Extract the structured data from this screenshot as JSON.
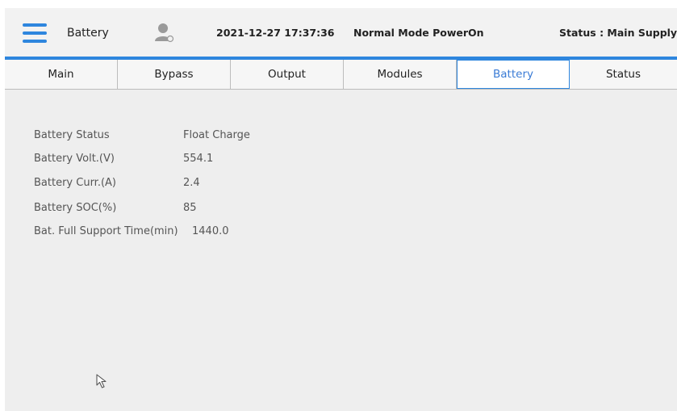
{
  "header": {
    "title": "Battery",
    "datetime": "2021-12-27 17:37:36",
    "mode": "Normal Mode  PowerOn",
    "status": "Status : Main Supply",
    "accent_color": "#2e86de"
  },
  "tabs": [
    {
      "label": "Main"
    },
    {
      "label": "Bypass"
    },
    {
      "label": "Output"
    },
    {
      "label": "Modules"
    },
    {
      "label": "Battery",
      "active": true
    },
    {
      "label": "Status"
    }
  ],
  "battery": [
    {
      "label": "Battery Status",
      "value": "Float Charge"
    },
    {
      "label": "Battery Volt.(V)",
      "value": "554.1"
    },
    {
      "label": "Battery Curr.(A)",
      "value": "2.4"
    },
    {
      "label": "Battery SOC(%)",
      "value": "85"
    },
    {
      "label": "Bat. Full Support Time(min)",
      "value": "1440.0"
    }
  ],
  "icons": {
    "menu": "hamburger-menu-icon",
    "user": "user-icon",
    "pointer": "mouse-pointer-icon"
  }
}
